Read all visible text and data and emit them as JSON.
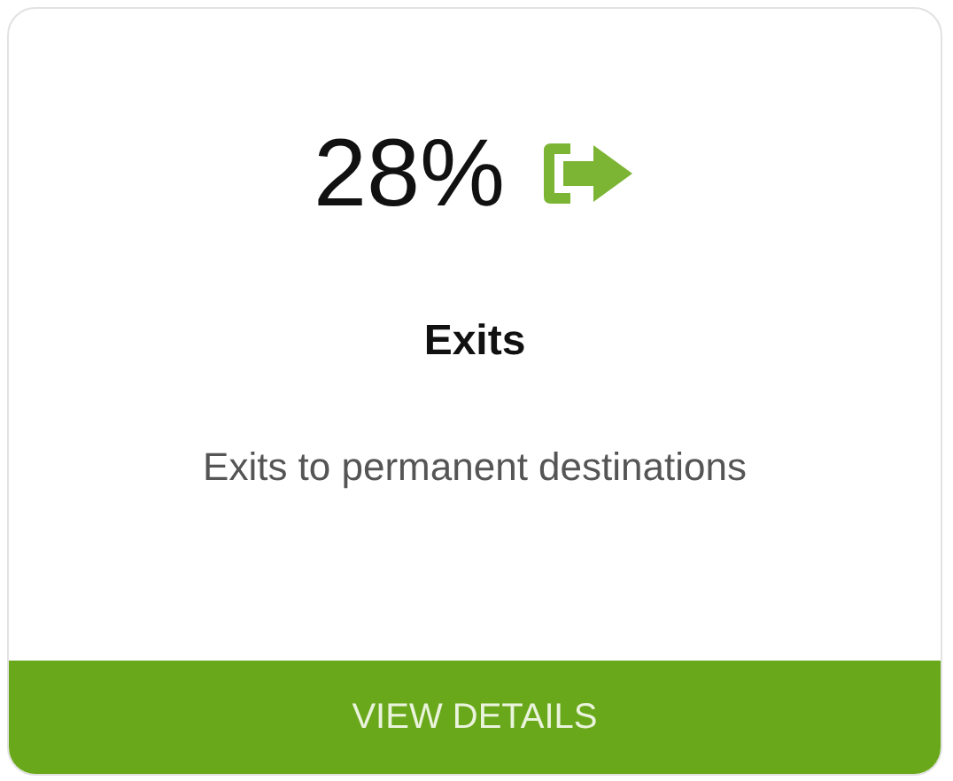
{
  "card": {
    "value": "28%",
    "title": "Exits",
    "description": "Exits to permanent destinations",
    "button": "VIEW DETAILS"
  }
}
